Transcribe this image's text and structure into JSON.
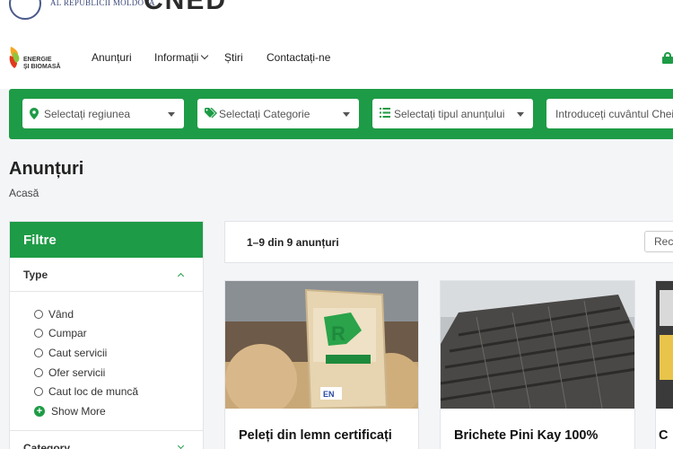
{
  "gov": {
    "text": "AL REPUBLICII MOLDOVA",
    "logo": "CNED"
  },
  "brand": {
    "line1": "ENERGIE",
    "line2": "ȘI BIOMASĂ"
  },
  "nav": {
    "items": [
      "Anunțuri",
      "Informații",
      "Știri",
      "Contactați-ne"
    ]
  },
  "search": {
    "region": "Selectați regiunea",
    "category": "Selectați Categorie",
    "type": "Selectați tipul anunțului",
    "keyword_placeholder": "Introduceți cuvântul Cheie"
  },
  "page": {
    "title": "Anunțuri",
    "breadcrumb": "Acasă"
  },
  "filters": {
    "title": "Filtre",
    "group1": "Type",
    "options": [
      "Vând",
      "Cumpar",
      "Caut servicii",
      "Ofer servicii",
      "Caut loc de muncă"
    ],
    "show_more": "Show More",
    "group2": "Category"
  },
  "results": {
    "count": "1–9 din 9 anunțuri",
    "sort": "Recent"
  },
  "cards": [
    {
      "title": "Peleți din lemn certificați"
    },
    {
      "title": "Brichete Pini Kay 100%"
    },
    {
      "title": "C"
    }
  ],
  "colors": {
    "accent": "#1e9b46"
  }
}
